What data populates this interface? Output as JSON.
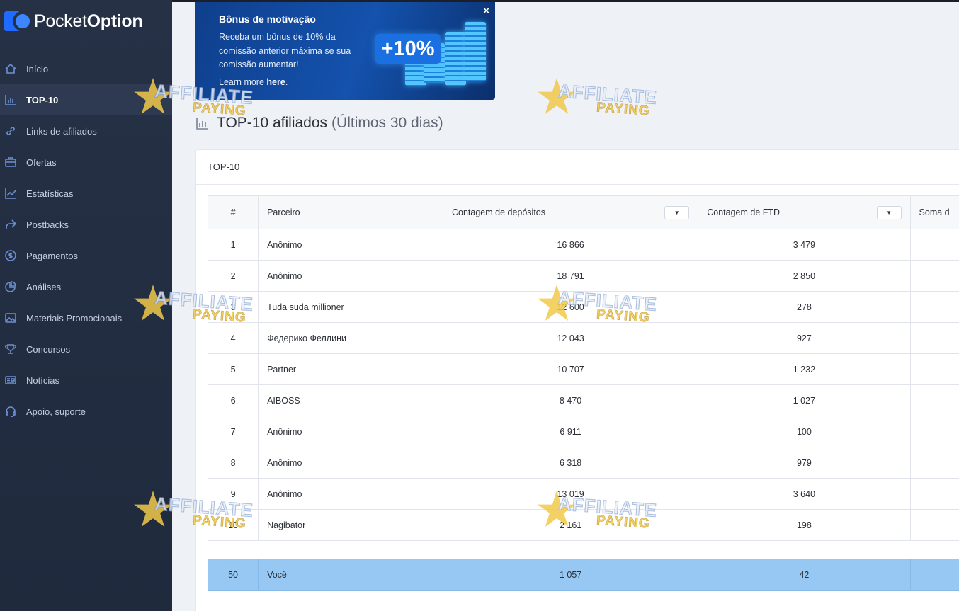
{
  "app": {
    "brand_regular": "Pocket",
    "brand_bold": "Option"
  },
  "sidebar": {
    "items": [
      {
        "label": "Início",
        "icon": "home-icon"
      },
      {
        "label": "TOP-10",
        "icon": "bar-chart-icon",
        "active": true
      },
      {
        "label": "Links de afiliados",
        "icon": "link-icon"
      },
      {
        "label": "Ofertas",
        "icon": "briefcase-icon"
      },
      {
        "label": "Estatísticas",
        "icon": "line-chart-icon"
      },
      {
        "label": "Postbacks",
        "icon": "share-arrow-icon"
      },
      {
        "label": "Pagamentos",
        "icon": "dollar-circle-icon"
      },
      {
        "label": "Análises",
        "icon": "pie-chart-icon"
      },
      {
        "label": "Materiais Promocionais",
        "icon": "image-icon"
      },
      {
        "label": "Concursos",
        "icon": "trophy-icon"
      },
      {
        "label": "Notícias",
        "icon": "newspaper-icon"
      },
      {
        "label": "Apoio, suporte",
        "icon": "headset-icon"
      }
    ]
  },
  "banner": {
    "title": "Bônus de motivação",
    "text": "Receba um bônus de 10% da comissão anterior máxima se sua comissão aumentar!",
    "learn_more_prefix": "Learn more ",
    "learn_more_link": "here",
    "learn_more_suffix": ".",
    "badge": "+10%",
    "close": "×"
  },
  "page": {
    "title": "TOP-10 afiliados",
    "subtitle": "(Últimos 30 dias)"
  },
  "card": {
    "title": "TOP-10"
  },
  "table": {
    "headers": [
      "#",
      "Parceiro",
      "Contagem de depósitos",
      "Contagem de FTD",
      "Soma d"
    ],
    "rows": [
      {
        "rank": "1",
        "partner": "Anônimo",
        "deposits": "16 866",
        "ftd": "3 479"
      },
      {
        "rank": "2",
        "partner": "Anônimo",
        "deposits": "18 791",
        "ftd": "2 850"
      },
      {
        "rank": "3",
        "partner": "Tuda suda millioner",
        "deposits": "12 600",
        "ftd": "278"
      },
      {
        "rank": "4",
        "partner": "Федерико Феллини",
        "deposits": "12 043",
        "ftd": "927"
      },
      {
        "rank": "5",
        "partner": "Partner",
        "deposits": "10 707",
        "ftd": "1 232"
      },
      {
        "rank": "6",
        "partner": "AIBOSS",
        "deposits": "8 470",
        "ftd": "1 027"
      },
      {
        "rank": "7",
        "partner": "Anônimo",
        "deposits": "6 911",
        "ftd": "100"
      },
      {
        "rank": "8",
        "partner": "Anônimo",
        "deposits": "6 318",
        "ftd": "979"
      },
      {
        "rank": "9",
        "partner": "Anônimo",
        "deposits": "13 019",
        "ftd": "3 640"
      },
      {
        "rank": "10",
        "partner": "Nagibator",
        "deposits": "2 161",
        "ftd": "198"
      }
    ],
    "you": {
      "rank": "50",
      "partner": "Você",
      "deposits": "1 057",
      "ftd": "42"
    }
  },
  "watermark": {
    "line1": "AFFILIATE",
    "line2": "PAYING"
  },
  "colors": {
    "sidebar": "#263146",
    "accent": "#1f6bff",
    "highlight_row": "#97c8f4"
  }
}
